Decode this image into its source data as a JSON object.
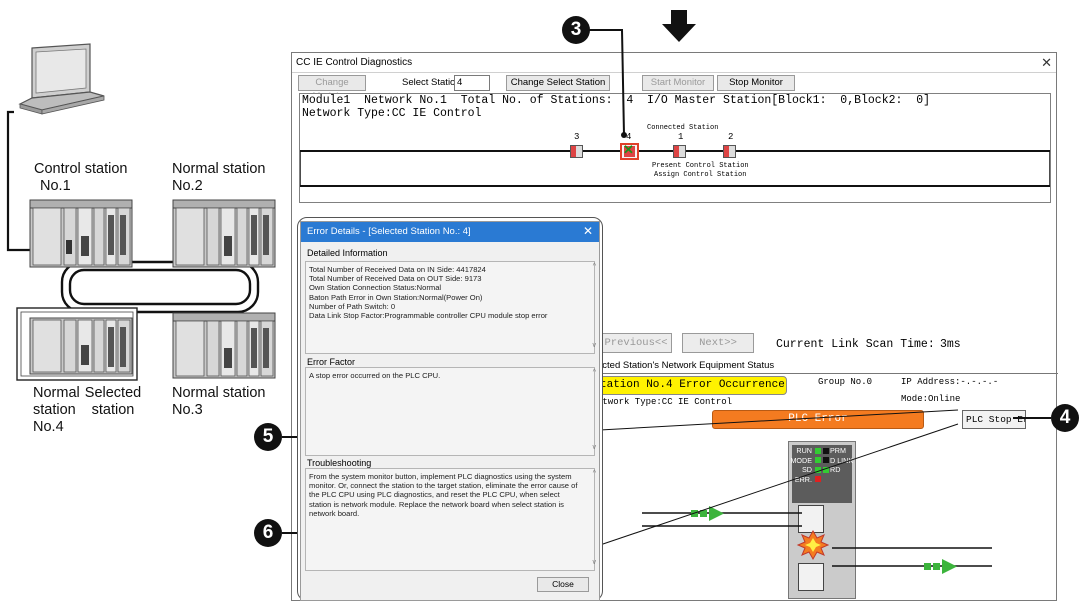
{
  "network": {
    "control_station": {
      "label_line1": "Control station",
      "label_line2": "No.1"
    },
    "normal_station_2": {
      "label_line1": "Normal station",
      "label_line2": "No.2"
    },
    "normal_station_3": {
      "label_line1": "Normal station",
      "label_line2": "No.3"
    },
    "normal_station_4": {
      "label_line1": "Normal",
      "label_line2": "station",
      "label_line3": "No.4"
    },
    "selected_station": {
      "label_line1": "Selected",
      "label_line2": "station"
    }
  },
  "window": {
    "title": "CC IE Control Diagnostics",
    "toolbar": {
      "change_module": "Change Module...",
      "select_station_label": "Select Station",
      "select_station_value": "4",
      "change_select_station": "Change Select Station",
      "start_monitor": "Start Monitor",
      "stop_monitor": "Stop Monitor"
    },
    "summary_line1": "Module1  Network No.1  Total No. of Stations:  4  I/O Master Station[Block1:  0,Block2:  0]",
    "summary_line2": "Network Type:CC IE Control",
    "topology": {
      "connected_station_label": "Connected Station",
      "station_numbers": [
        "3",
        "4",
        "1",
        "2"
      ],
      "present_control_station": "Present Control Station",
      "assign_control_station": "Assign Control Station"
    },
    "nav": {
      "previous": "Previous<<",
      "next": "Next>>",
      "link_scan_label": "Current Link Scan Time:",
      "link_scan_value": "3ms"
    },
    "equipment_status_header": "ected Station's Network Equipment Status",
    "station_status": "tation No.4  Error Occurrence",
    "group_no": "Group No.0",
    "ip_address": "IP Address:-.-.-.-",
    "network_type": "etwork Type:CC IE Control",
    "mode": "Mode:Online",
    "plc_error": "PLC Error",
    "plc_stop_error": "PLC Stop Erro",
    "leds": {
      "run": "RUN",
      "mode": "MODE",
      "sd": "SD",
      "err": "ERR.",
      "prm": "PRM",
      "dlink": "D LINK",
      "rd": "RD"
    }
  },
  "error_dialog": {
    "title": "Error Details - [Selected Station No.:  4]",
    "detailed_label": "Detailed Information",
    "detailed_text": "Total Number of Received Data on IN Side: 4417824\nTotal Number of Received Data on OUT Side: 9173\nOwn Station Connection Status:Normal\nBaton Path Error in Own Station:Normal(Power On)\nNumber of Path Switch: 0\nData Link Stop Factor:Programmable controller CPU module stop error",
    "factor_label": "Error Factor",
    "factor_text": "A stop error occurred on the PLC CPU.",
    "troubleshooting_label": "Troubleshooting",
    "troubleshooting_text": "From the system monitor button, implement PLC diagnostics using the system monitor. Or, connect the station to the target station, eliminate the error cause of the PLC CPU using PLC diagnostics, and reset the PLC CPU, when select station is network module. Replace the network board when select station is network board.",
    "close": "Close"
  },
  "callouts": [
    "3",
    "4",
    "5",
    "6"
  ],
  "colors": {
    "accent_blue": "#2a7ad3",
    "error_orange": "#f47b20",
    "status_yellow": "#fff200",
    "led_green": "#33cc33",
    "led_red": "#e02020",
    "arrow_green": "#3cb43c"
  }
}
